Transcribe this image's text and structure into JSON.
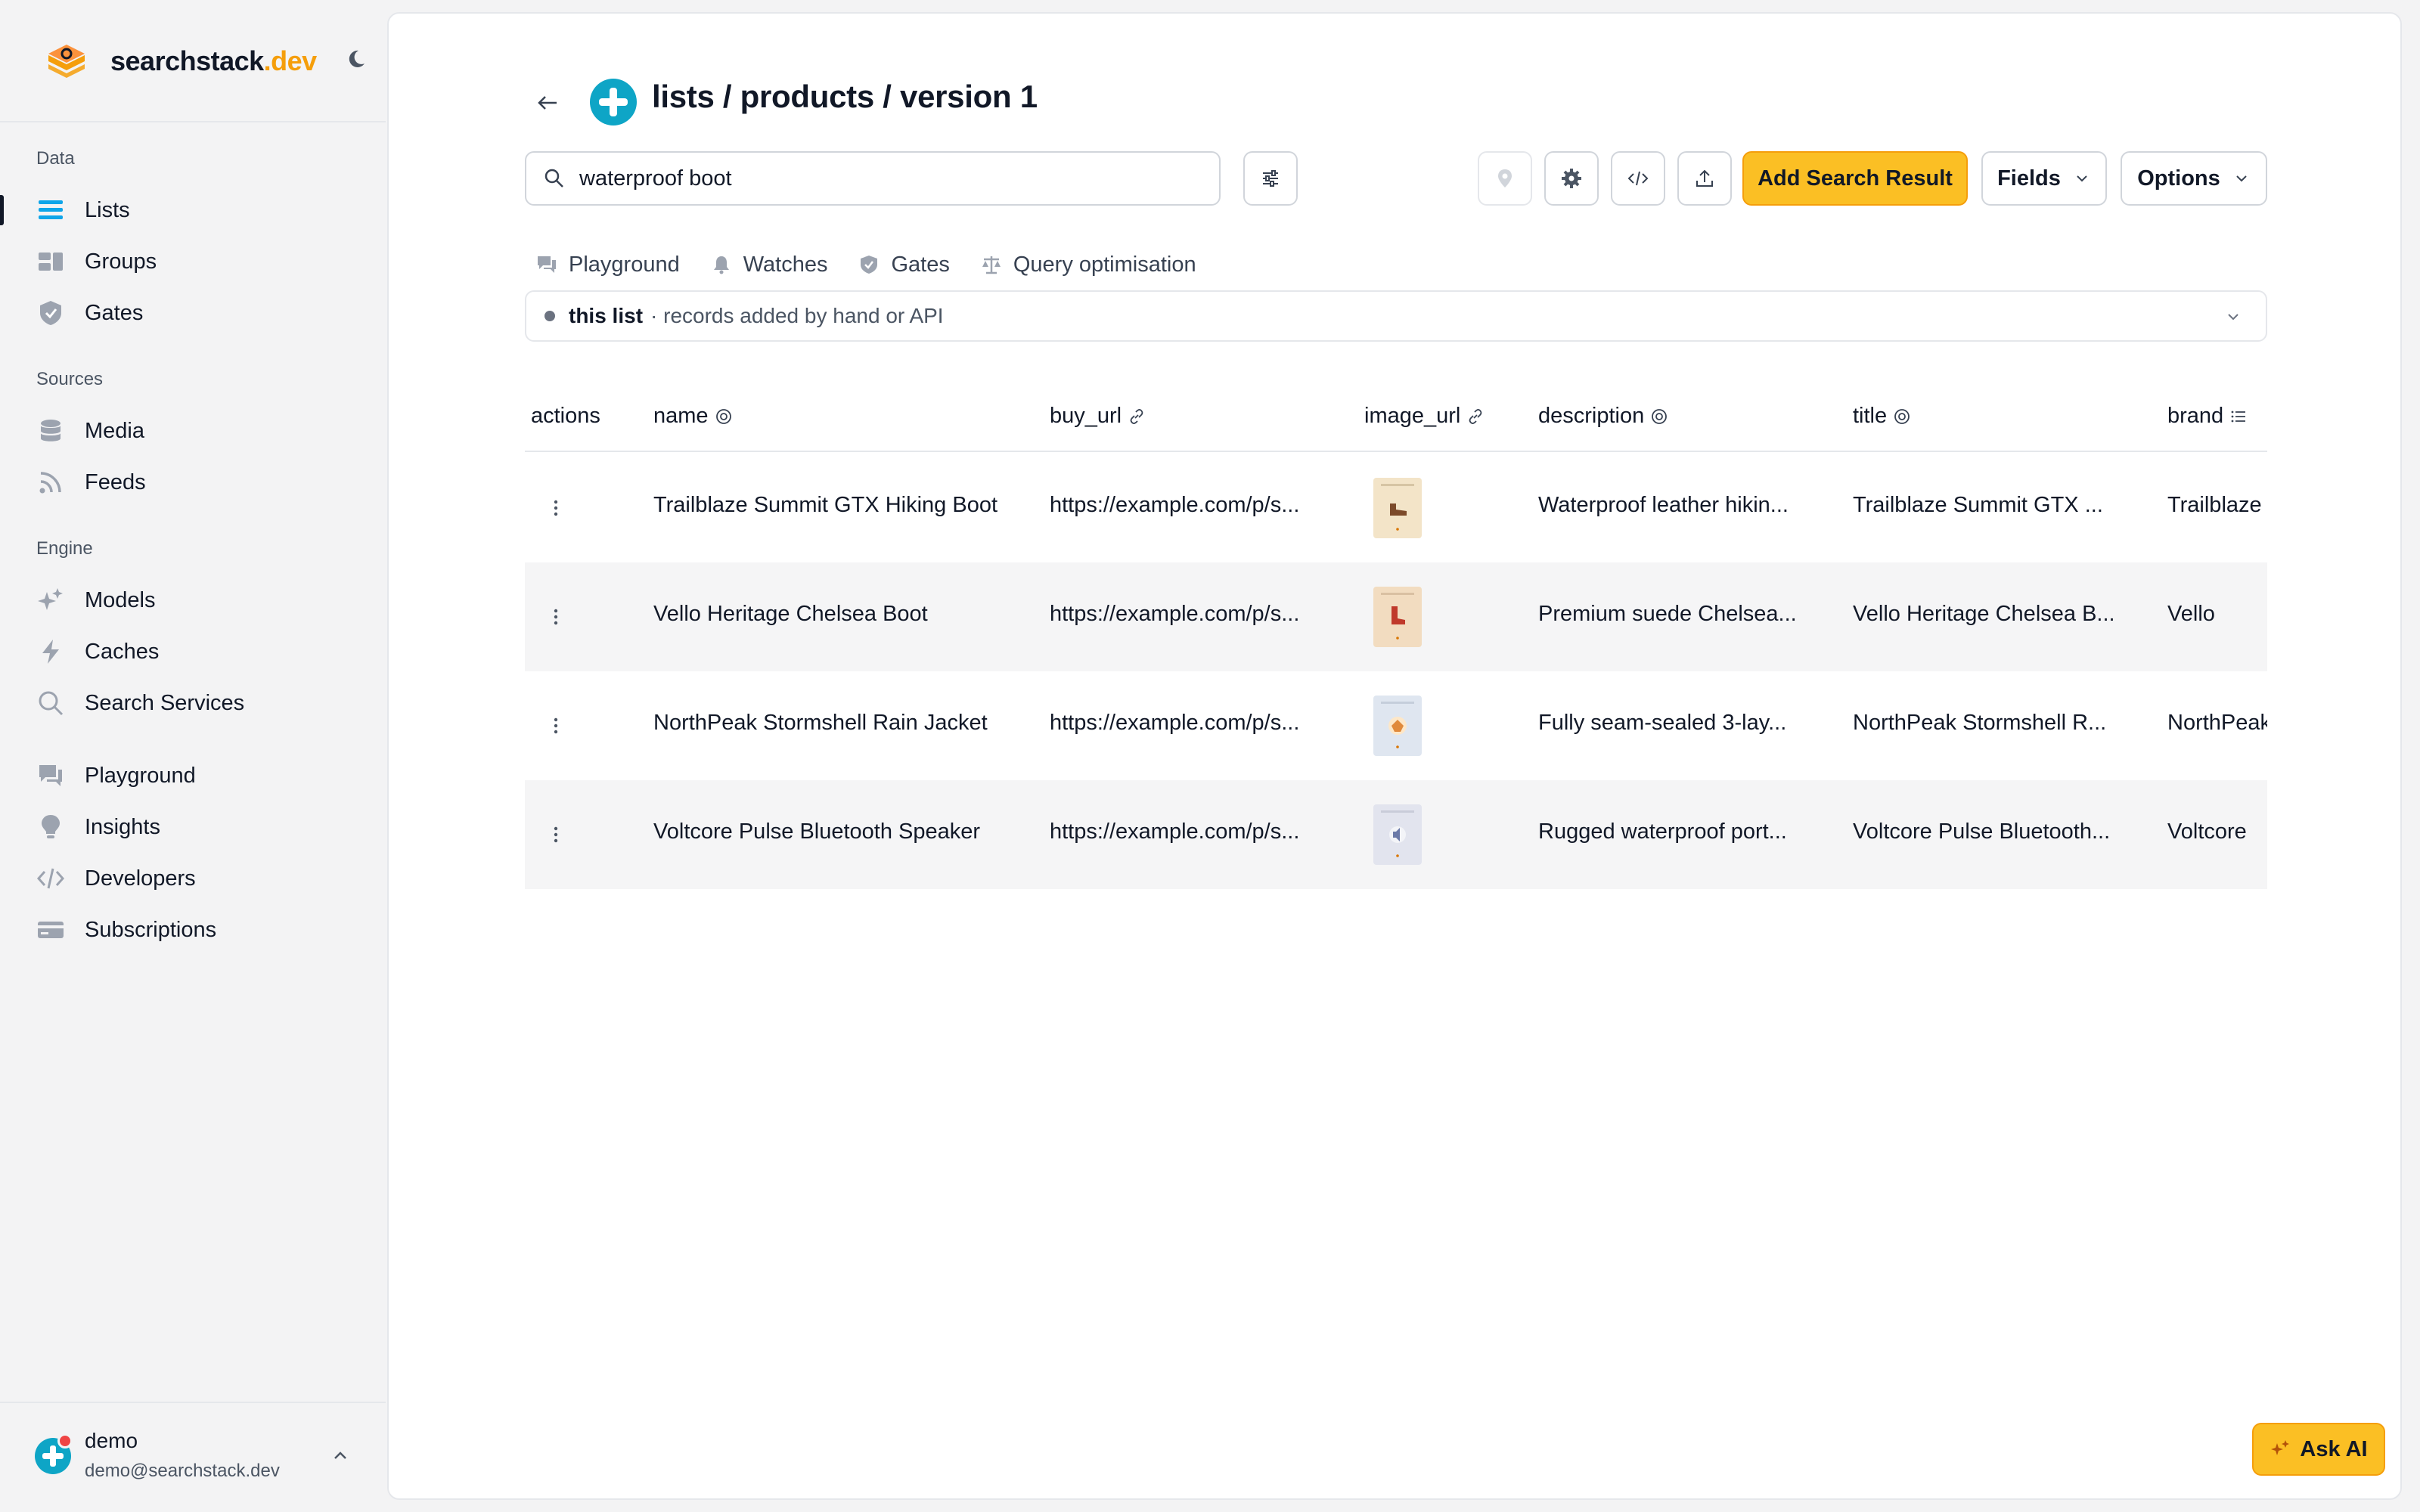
{
  "brand": {
    "name_main": "searchstack",
    "name_accent": ".dev"
  },
  "sidebar": {
    "sections": {
      "data": "Data",
      "sources": "Sources",
      "engine": "Engine"
    },
    "items": {
      "lists": "Lists",
      "groups": "Groups",
      "gates": "Gates",
      "media": "Media",
      "feeds": "Feeds",
      "models": "Models",
      "caches": "Caches",
      "search_services": "Search Services",
      "playground": "Playground",
      "insights": "Insights",
      "developers": "Developers",
      "subscriptions": "Subscriptions"
    },
    "active": "lists"
  },
  "user": {
    "name": "demo",
    "email": "demo@searchstack.dev"
  },
  "header": {
    "title": "lists / products / version 1"
  },
  "toolbar": {
    "search_value": "waterproof boot",
    "add_label": "Add Search Result",
    "fields_label": "Fields",
    "options_label": "Options"
  },
  "tabs": {
    "playground": "Playground",
    "watches": "Watches",
    "gates": "Gates",
    "query_optimisation": "Query optimisation"
  },
  "source": {
    "name": "this list",
    "description": "· records added by hand or API"
  },
  "table": {
    "columns": {
      "actions": "actions",
      "name": "name",
      "buy_url": "buy_url",
      "image_url": "image_url",
      "description": "description",
      "title": "title",
      "brand": "brand"
    },
    "rows": [
      {
        "name": "Trailblaze Summit GTX Hiking Boot",
        "buy_url": "https://example.com/p/s...",
        "description": "Waterproof leather hikin...",
        "title": "Trailblaze Summit GTX ...",
        "brand": "Trailblaze",
        "thumb_color": "#f3e4c8"
      },
      {
        "name": "Vello Heritage Chelsea Boot",
        "buy_url": "https://example.com/p/s...",
        "description": "Premium suede Chelsea...",
        "title": "Vello Heritage Chelsea B...",
        "brand": "Vello",
        "thumb_color": "#f2dcc0"
      },
      {
        "name": "NorthPeak Stormshell Rain Jacket",
        "buy_url": "https://example.com/p/s...",
        "description": "Fully seam-sealed 3-lay...",
        "title": "NorthPeak Stormshell R...",
        "brand": "NorthPeak",
        "thumb_color": "#dfe6f0"
      },
      {
        "name": "Voltcore Pulse Bluetooth Speaker",
        "buy_url": "https://example.com/p/s...",
        "description": "Rugged waterproof port...",
        "title": "Voltcore Pulse Bluetooth...",
        "brand": "Voltcore",
        "thumb_color": "#e2e4ee"
      }
    ]
  },
  "ask_ai": {
    "label": "Ask AI"
  },
  "colors": {
    "accent": "#fbbf24",
    "accent_text": "#f59e0b",
    "brand_icon": "#0ea5c6"
  }
}
